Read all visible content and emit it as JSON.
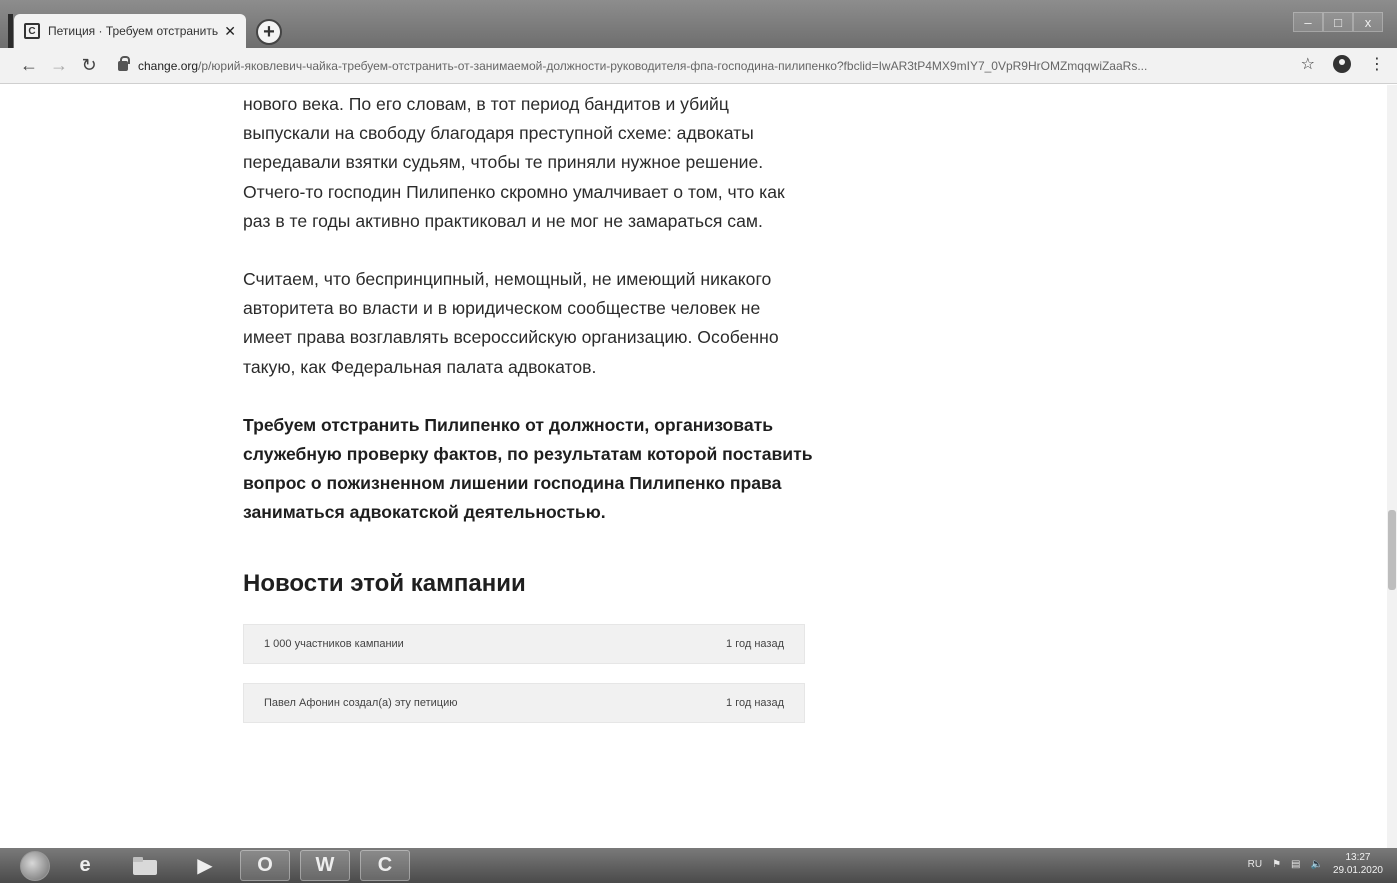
{
  "browser": {
    "tab_title": "Петиция · Требуем отстранить",
    "tab_favicon": "C",
    "new_tab_symbol": "+",
    "window_controls": [
      "–",
      "□",
      "x"
    ],
    "url_host": "change.org",
    "url_path": "/p/юрий-яковлевич-чайка-требуем-отстранить-от-занимаемой-должности-руководителя-фпа-господина-пилипенко?fbclid=IwAR3tP4MX9mIY7_0VpR9HrOMZmqqwiZaaRs..."
  },
  "article": {
    "paragraph_1": "нового века. По его словам, в тот период бандитов и убийц выпускали на свободу благодаря преступной схеме: адвокаты передавали взятки судьям, чтобы те приняли нужное решение. Отчего-то господин Пилипенко скромно умалчивает о том, что как раз в те годы активно практиковал и не мог не замараться сам.",
    "paragraph_2": "Считаем, что беспринципный, немощный, не имеющий никакого авторитета во власти и в юридическом сообществе человек не имеет права возглавлять всероссийскую организацию. Особенно такую, как Федеральная палата адвокатов.",
    "paragraph_3": "Требуем отстранить Пилипенко от должности, организовать служебную проверку фактов, по результатам которой поставить вопрос о пожизненном лишении господина Пилипенко права заниматься адвокатской деятельностью."
  },
  "news": {
    "heading": "Новости этой кампании",
    "items": [
      {
        "text": "1 000 участников кампании",
        "time": "1 год назад"
      },
      {
        "text": "Павел Афонин создал(а) эту петицию",
        "time": "1 год назад"
      }
    ]
  },
  "taskbar": {
    "apps": [
      "e",
      "",
      "▶",
      "O",
      "W",
      "C"
    ],
    "tray": {
      "lang": "RU",
      "time": "13:27",
      "date": "29.01.2020"
    }
  }
}
